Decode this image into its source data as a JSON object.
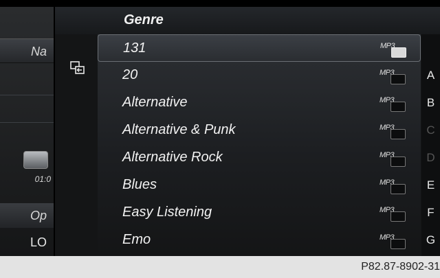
{
  "background": {
    "nav_label": "Na",
    "time_label": "01:0",
    "options_label": "Op",
    "lo_label": "LO"
  },
  "header": {
    "title": "Genre"
  },
  "list": {
    "items": [
      {
        "label": "131",
        "badge": "MP3",
        "selected": true
      },
      {
        "label": "20",
        "badge": "MP3"
      },
      {
        "label": "Alternative",
        "badge": "MP3"
      },
      {
        "label": "Alternative & Punk",
        "badge": "MP3"
      },
      {
        "label": "Alternative Rock",
        "badge": "MP3"
      },
      {
        "label": "Blues",
        "badge": "MP3"
      },
      {
        "label": "Easy Listening",
        "badge": "MP3"
      },
      {
        "label": "Emo",
        "badge": "MP3"
      }
    ]
  },
  "alphabet": {
    "letters": [
      {
        "letter": "A",
        "enabled": true
      },
      {
        "letter": "B",
        "enabled": true
      },
      {
        "letter": "C",
        "enabled": false
      },
      {
        "letter": "D",
        "enabled": false
      },
      {
        "letter": "E",
        "enabled": true
      },
      {
        "letter": "F",
        "enabled": true
      },
      {
        "letter": "G",
        "enabled": true
      }
    ]
  },
  "footer": {
    "code": "P82.87-8902-31"
  },
  "colors": {
    "background": "#141516",
    "text": "#f2f2f2",
    "footer_bg": "#e3e3e3"
  }
}
